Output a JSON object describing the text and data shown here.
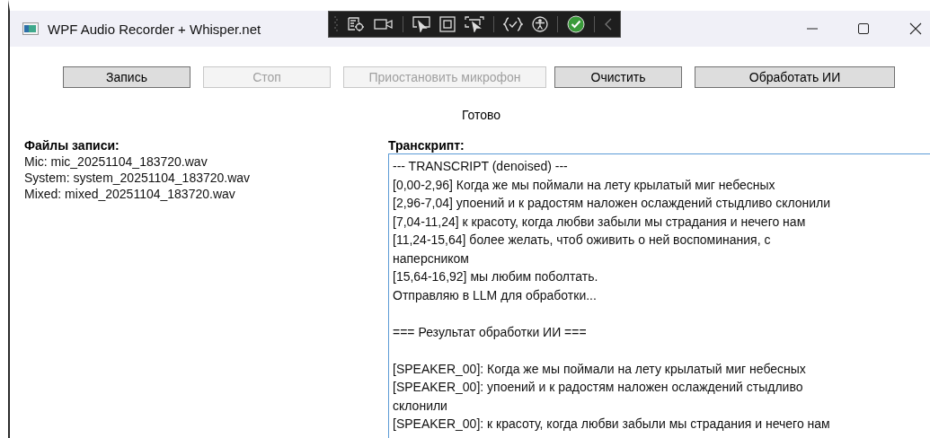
{
  "window": {
    "title": "WPF Audio Recorder + Whisper.net"
  },
  "debug_toolbar": {
    "status_ok": true
  },
  "buttons": [
    {
      "label": "Запись",
      "disabled": false
    },
    {
      "label": "Стоп",
      "disabled": true
    },
    {
      "label": "Приостановить микрофон",
      "disabled": true
    },
    {
      "label": "Очистить",
      "disabled": false
    },
    {
      "label": "Обработать ИИ",
      "disabled": false
    }
  ],
  "status": "Готово",
  "files": {
    "heading": "Файлы записи:",
    "lines": [
      "Mic: mic_20251104_183720.wav",
      "System: system_20251104_183720.wav",
      "Mixed: mixed_20251104_183720.wav"
    ]
  },
  "transcript": {
    "heading": "Транскрипт:",
    "paragraphs": [
      [
        "--- TRANSCRIPT (denoised) ---",
        "[0,00-2,96] Когда же мы поймали на лету крылатый миг небесных",
        "[2,96-7,04] упоений и к радостям наложен ослаждений стыдливо склонили",
        "[7,04-11,24] к красоту, когда любви забыли мы страдания и нечего нам",
        "[11,24-15,64] более желать, чтоб оживить о ней воспоминания, с",
        "наперсником",
        "[15,64-16,92] мы любим поболтать.",
        "Отправляю в LLM для обработки..."
      ],
      [
        "=== Результат обработки ИИ ==="
      ],
      [
        "[SPEAKER_00]: Когда же мы поймали на лету крылатый миг небесных",
        "[SPEAKER_00]: упоений и к радостям наложен ослаждений стыдливо",
        "склонили",
        "[SPEAKER_00]: к красоту, когда любви забыли мы страдания и нечего нам"
      ]
    ]
  }
}
